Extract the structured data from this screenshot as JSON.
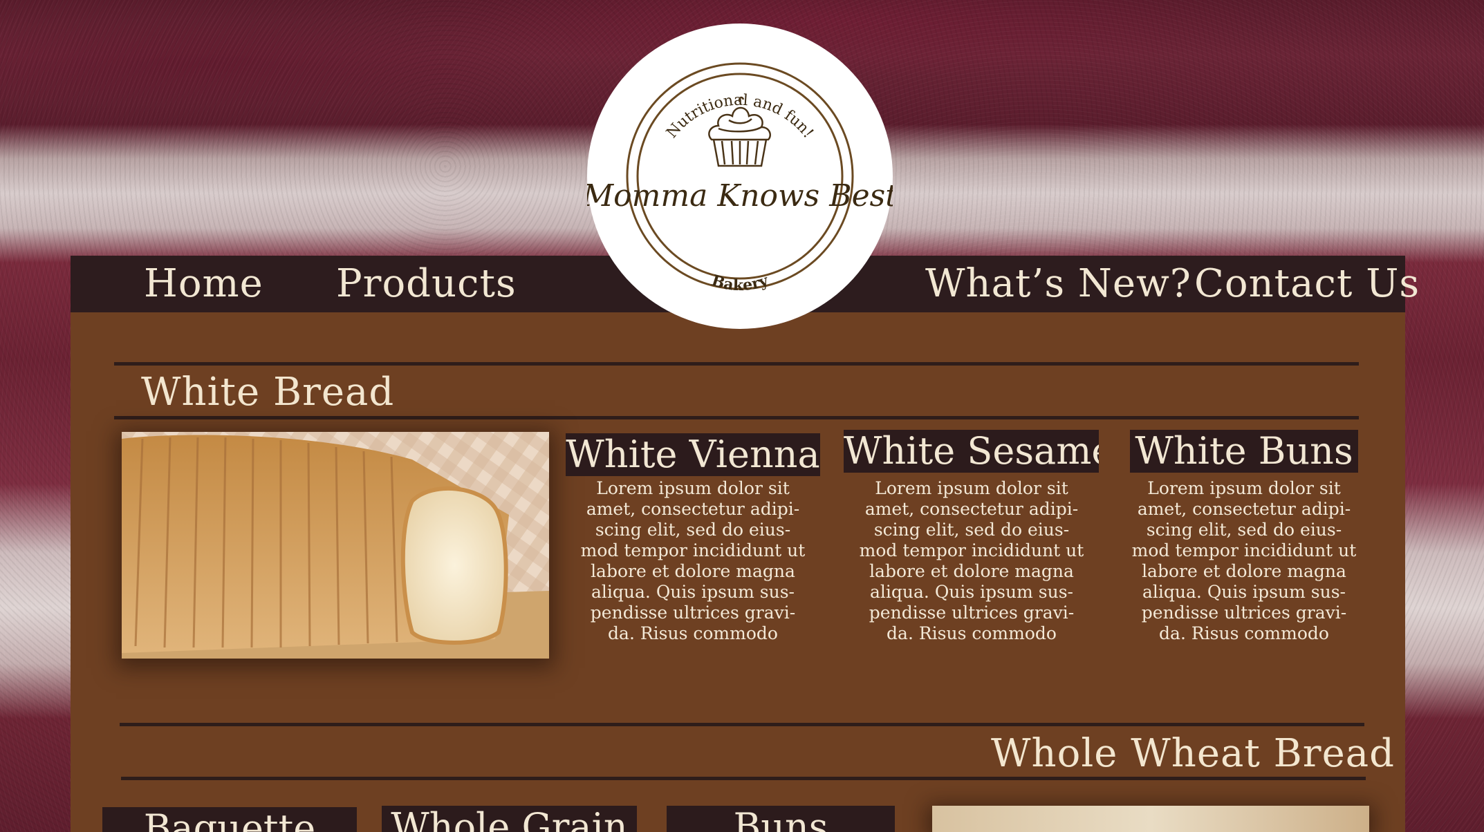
{
  "nav": {
    "left": [
      "Home",
      "Products"
    ],
    "right": [
      "What’s New?",
      "Contact Us"
    ]
  },
  "logo": {
    "top_text": "Nutritional and fun!",
    "name": "Momma Knows Best",
    "bottom_text": "Bakery",
    "icon": "cupcake-icon"
  },
  "sections": {
    "white_bread": {
      "title": "White Bread",
      "products": [
        {
          "name": "White Vienna",
          "desc": "Lorem ipsum dolor sit amet, consectetur adipi-scing elit, sed do eius-mod tempor incididunt ut labore et dolore magna aliqua. Quis ipsum sus-pendisse ultrices gravi-da. Risus commodo"
        },
        {
          "name": "White Sesame",
          "desc": "Lorem ipsum dolor sit amet, consectetur adipi-scing elit, sed do eius-mod tempor incididunt ut labore et dolore magna aliqua. Quis ipsum sus-pendisse ultrices gravi-da. Risus commodo"
        },
        {
          "name": "White Buns",
          "desc": "Lorem ipsum dolor sit amet, consectetur adipi-scing elit, sed do eius-mod tempor incididunt ut labore et dolore magna aliqua. Quis ipsum sus-pendisse ultrices gravi-da. Risus commodo"
        }
      ]
    },
    "whole_wheat": {
      "title": "Whole Wheat Bread",
      "products": [
        {
          "name": "Baguette"
        },
        {
          "name": "Whole Grain"
        },
        {
          "name": "Buns"
        }
      ]
    }
  },
  "colors": {
    "nav_bg": "#2d1c1e",
    "page_bg": "#6e4022",
    "text_cream": "#f2e7d3",
    "logo_ink": "#6b4a22"
  }
}
